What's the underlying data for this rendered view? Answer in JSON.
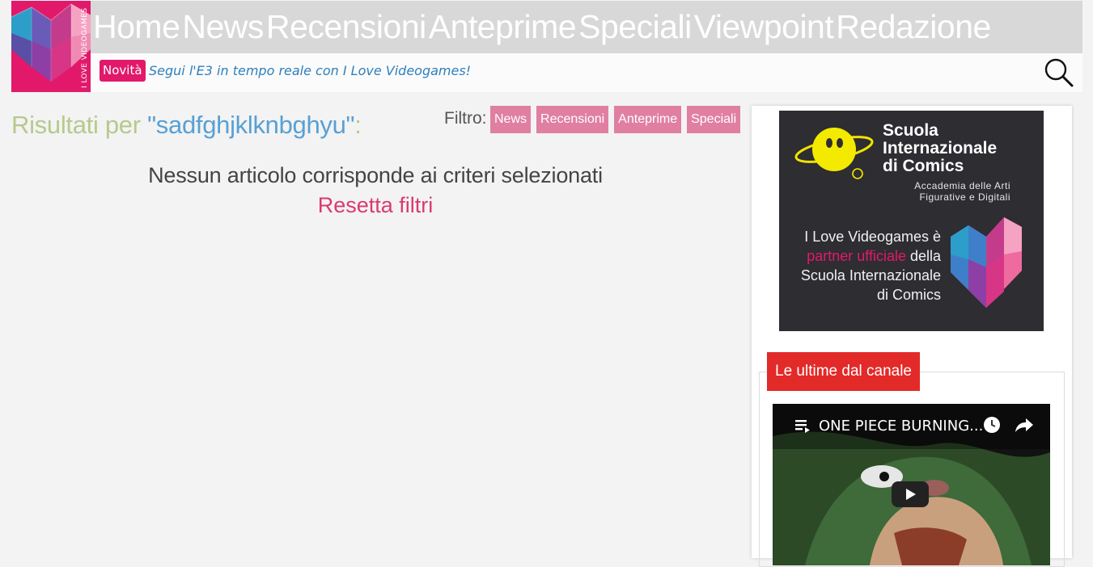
{
  "header": {
    "logo_text": "I LOVE VIDEOGAMES",
    "nav": [
      "Home",
      "News",
      "Recensioni",
      "Anteprime",
      "Speciali",
      "Viewpoint",
      "Redazione"
    ],
    "ticker": {
      "badge": "Novità",
      "text": "Segui l'E3 in tempo reale con I Love Videogames!"
    },
    "search_icon": "search-icon"
  },
  "results": {
    "prefix": "Risultati per ",
    "query": "\"sadfghjklknbghyu\"",
    "suffix": ":",
    "filter_label": "Filtro:",
    "filters": [
      "News",
      "Recensioni",
      "Anteprime",
      "Speciali"
    ],
    "empty_message": "Nessun articolo corrisponde ai criteri selezionati",
    "reset_label": "Resetta filtri"
  },
  "sidebar": {
    "ad": {
      "school_name": [
        "Scuola",
        "Internazionale",
        "di Comics"
      ],
      "school_sub": [
        "Accademia delle Arti",
        "Figurative e Digitali"
      ],
      "tag_line_1": "I Love Videogames è",
      "tag_highlight": "partner ufficiale",
      "tag_line_2": " della",
      "tag_line_3": "Scuola Internazionale",
      "tag_line_4": "di Comics"
    },
    "channel": {
      "title": "Le ultime dal canale",
      "video_title": "ONE PIECE BURNING..."
    }
  },
  "colors": {
    "brand_pink": "#e2196a",
    "filter_pink": "#e07fa1",
    "channel_red": "#e22a29",
    "query_blue": "#58a0d4",
    "title_green": "#b7c98c"
  }
}
